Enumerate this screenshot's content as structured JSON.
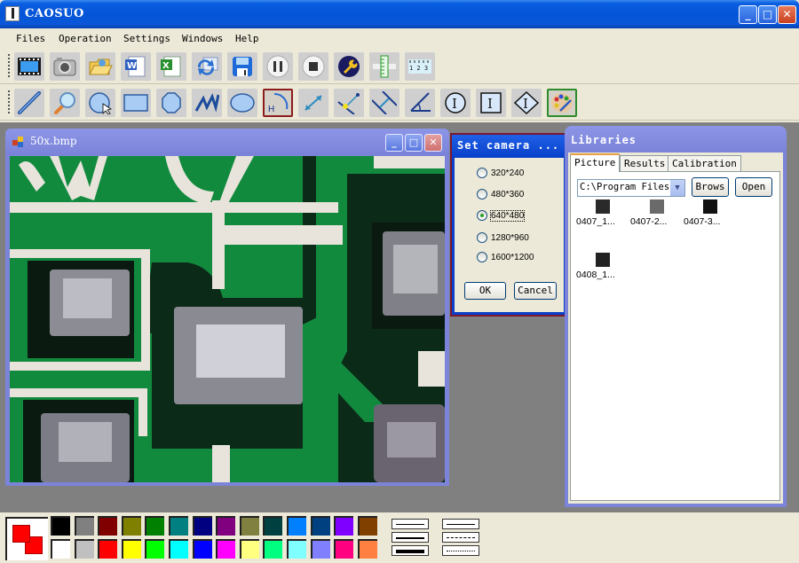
{
  "app": {
    "title": "CAOSUO",
    "window_controls": [
      "minimize",
      "maximize",
      "close"
    ]
  },
  "menu": [
    "Files",
    "Operation",
    "Settings",
    "Windows",
    "Help"
  ],
  "toolbar1": [
    {
      "name": "video-icon",
      "tooltip": "Video"
    },
    {
      "name": "camera-icon",
      "tooltip": "Capture"
    },
    {
      "name": "open-folder-icon",
      "tooltip": "Open"
    },
    {
      "name": "word-export-icon",
      "tooltip": "Export Word"
    },
    {
      "name": "excel-export-icon",
      "tooltip": "Export Excel"
    },
    {
      "name": "refresh-icon",
      "tooltip": "Refresh"
    },
    {
      "name": "save-icon",
      "tooltip": "Save"
    },
    {
      "name": "pause-icon",
      "tooltip": "Pause"
    },
    {
      "name": "stop-icon",
      "tooltip": "Stop"
    },
    {
      "name": "wrench-icon",
      "tooltip": "Settings"
    },
    {
      "name": "vertical-ruler-icon",
      "tooltip": "Ruler"
    },
    {
      "name": "horizontal-ruler-icon",
      "tooltip": "Scale",
      "ruler_digits": "1 2 3"
    }
  ],
  "toolbar2": [
    {
      "name": "line-tool-icon"
    },
    {
      "name": "zoom-tool-icon"
    },
    {
      "name": "circle-tool-icon"
    },
    {
      "name": "rectangle-tool-icon"
    },
    {
      "name": "polygon-tool-icon"
    },
    {
      "name": "polyline-tool-icon"
    },
    {
      "name": "ellipse-tool-icon"
    },
    {
      "name": "arc-height-tool-icon",
      "selected": true,
      "label": "H"
    },
    {
      "name": "distance-tool-icon"
    },
    {
      "name": "point-line-distance-icon"
    },
    {
      "name": "parallel-distance-icon"
    },
    {
      "name": "angle-tool-icon"
    },
    {
      "name": "circle-text-tool-icon",
      "label": "I"
    },
    {
      "name": "box-text-tool-icon",
      "label": "I"
    },
    {
      "name": "diamond-text-tool-icon",
      "label": "I"
    },
    {
      "name": "color-palette-icon",
      "selected": true
    }
  ],
  "image_window": {
    "title": "50x.bmp",
    "content": "PCB microscope image"
  },
  "camera_dialog": {
    "title": "Set camera ...",
    "options": [
      "320*240",
      "480*360",
      "640*480",
      "1280*960",
      "1600*1200"
    ],
    "selected": "640*480",
    "ok": "OK",
    "cancel": "Cancel"
  },
  "libraries": {
    "title": "Libraries",
    "tabs": [
      "Picture",
      "Results",
      "Calibration"
    ],
    "active_tab": "Picture",
    "path": "C:\\Program Files",
    "browse": "Brows",
    "open": "Open",
    "thumbnails": [
      {
        "caption": "0407_1...",
        "tone": "#2a2a2a"
      },
      {
        "caption": "0407-2...",
        "tone": "#6a6a6a"
      },
      {
        "caption": "0407-3...",
        "tone": "#111111"
      },
      {
        "caption": "0408_1...",
        "tone": "#222222"
      }
    ]
  },
  "palette": {
    "foreground": "#ff0000",
    "background": "#ff0000",
    "row1": [
      "#000000",
      "#808080",
      "#800000",
      "#808000",
      "#008000",
      "#008080",
      "#000080",
      "#800080",
      "#808040",
      "#004040",
      "#0080ff",
      "#004080",
      "#8000ff",
      "#804000"
    ],
    "row2": [
      "#ffffff",
      "#c0c0c0",
      "#ff0000",
      "#ffff00",
      "#00ff00",
      "#00ffff",
      "#0000ff",
      "#ff00ff",
      "#ffff80",
      "#00ff80",
      "#80ffff",
      "#8080ff",
      "#ff0080",
      "#ff8040"
    ],
    "line_widths": [
      "thin",
      "medium",
      "thick"
    ],
    "line_styles": [
      "solid",
      "dash-dot",
      "dotted"
    ]
  }
}
